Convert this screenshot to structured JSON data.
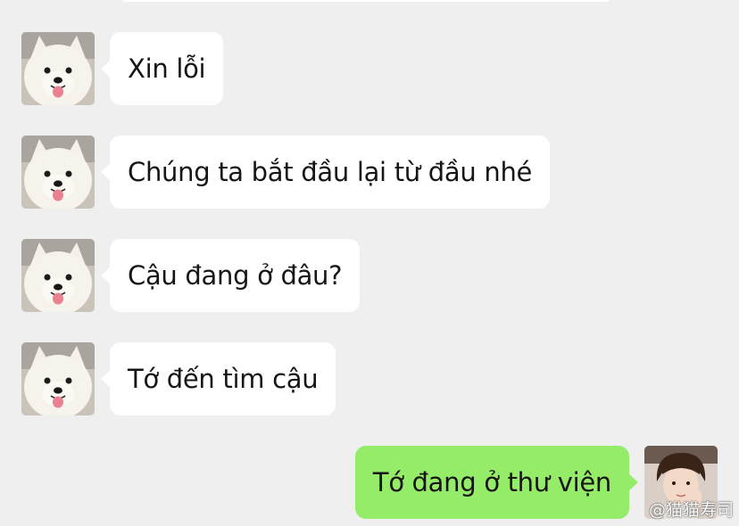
{
  "chat": {
    "messages": [
      {
        "sender": "contact",
        "avatar": "samoyed-dog-avatar",
        "text": "Xin lỗi"
      },
      {
        "sender": "contact",
        "avatar": "samoyed-dog-avatar",
        "text": "Chúng ta bắt đầu lại từ đầu nhé"
      },
      {
        "sender": "contact",
        "avatar": "samoyed-dog-avatar",
        "text": "Cậu đang ở đâu?"
      },
      {
        "sender": "contact",
        "avatar": "samoyed-dog-avatar",
        "text": "Tớ đến tìm cậu"
      },
      {
        "sender": "self",
        "avatar": "girl-photo-avatar",
        "text": "Tớ đang ở thư viện"
      }
    ]
  },
  "watermark": {
    "text": "@猫猫寿司"
  },
  "colors": {
    "background": "#efefef",
    "incoming_bubble": "#ffffff",
    "outgoing_bubble": "#95ec69",
    "text": "#161616"
  }
}
